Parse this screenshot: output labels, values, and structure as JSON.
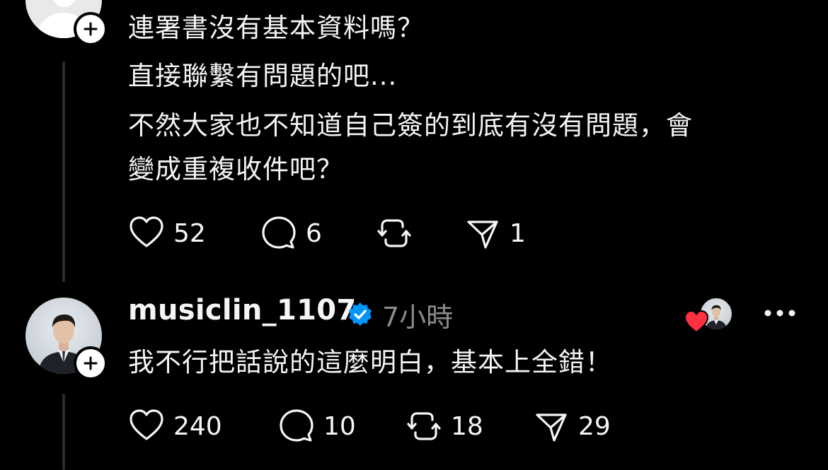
{
  "parent_post": {
    "text_lines": [
      "連署書沒有基本資料嗎？",
      "直接聯繫有問題的吧...",
      "不然大家也不知道自己簽的到底有沒有問題，會",
      "變成重複收件吧？"
    ],
    "actions": {
      "likes": "52",
      "replies": "6",
      "reposts": "",
      "shares": "1"
    }
  },
  "reply_post": {
    "username": "musiclin_1107",
    "timestamp": "7小時",
    "text": "我不行把話說的這麼明白，基本上全錯！",
    "actions": {
      "likes": "240",
      "replies": "10",
      "reposts": "18",
      "shares": "29"
    }
  },
  "icons": {
    "like": "heart-icon",
    "reply": "comment-icon",
    "repost": "repost-icon",
    "share": "send-icon",
    "follow": "plus-icon",
    "verified": "verified-badge-icon",
    "more": "more-icon"
  },
  "colors": {
    "background": "#000000",
    "text": "#f3f5f7",
    "muted": "#8b8b8b",
    "verified": "#0095f6",
    "liked_heart": "#ff3040",
    "thread_line": "#2b2b2b"
  }
}
